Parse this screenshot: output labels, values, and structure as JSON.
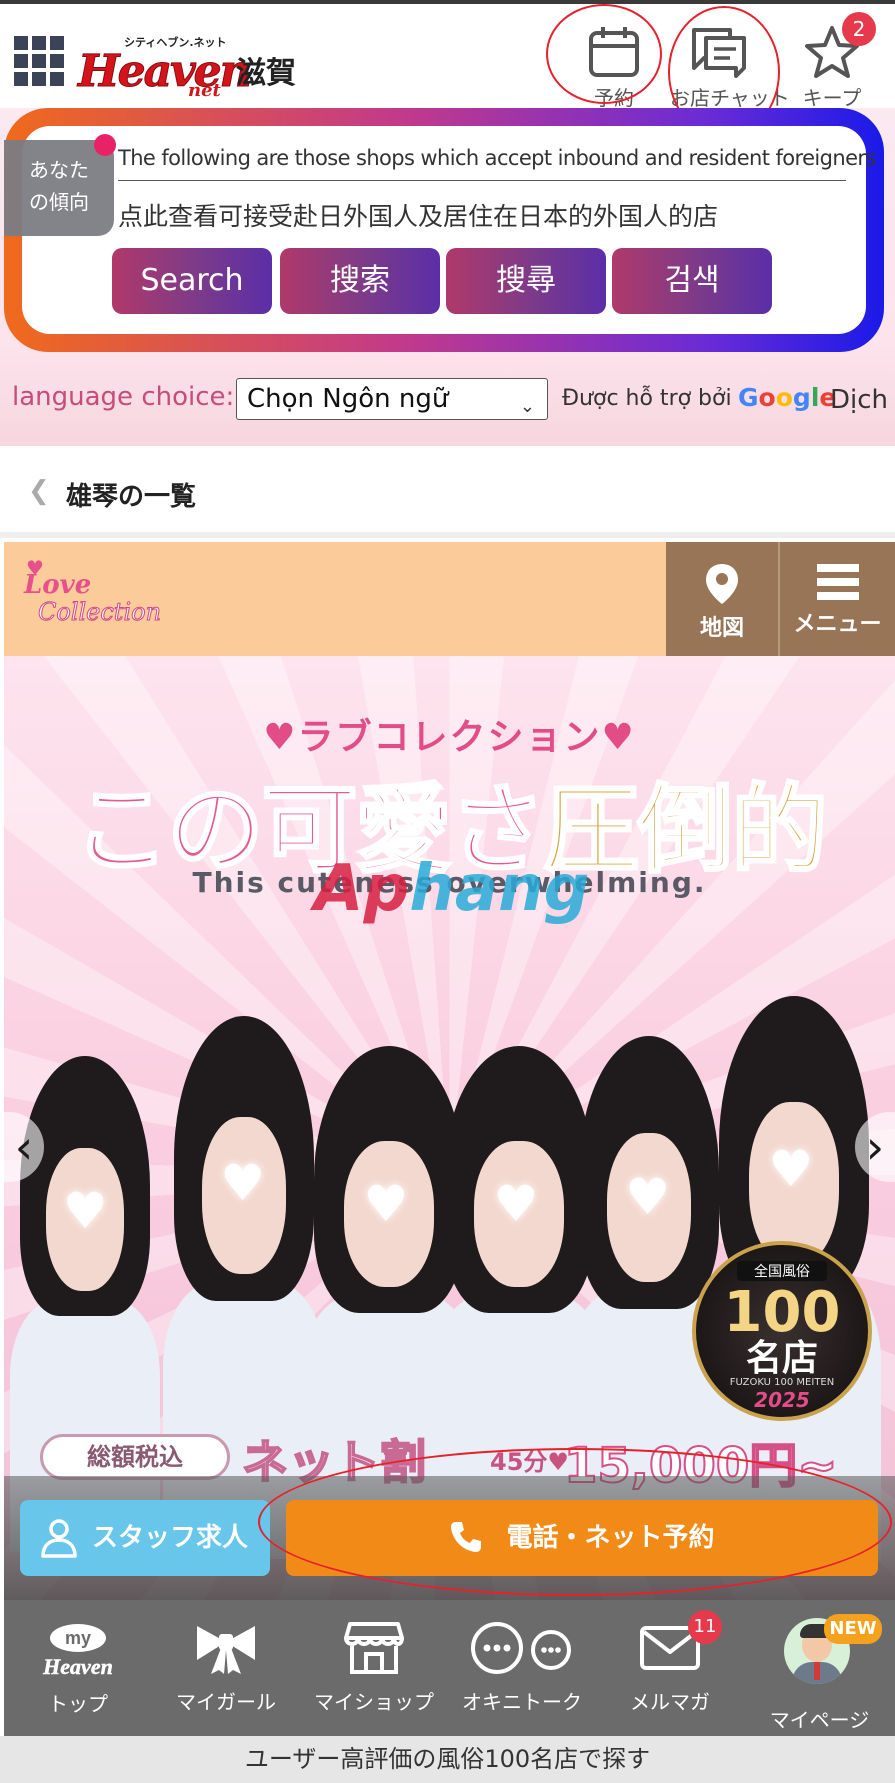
{
  "header": {
    "logo_tagline": "シティヘブン.ネット",
    "logo_name": "Heaven",
    "logo_suffix": "net",
    "region": "滋賀",
    "reserve_label": "予約",
    "chat_label": "お店チャット",
    "keep_label": "キープ",
    "keep_count": "2"
  },
  "language_banner": {
    "tendency_label_1": "あなた",
    "tendency_label_2": "の傾向",
    "en_text": "The following are those shops which accept inbound and resident foreigners",
    "zh_text": "点此查看可接受赴日外国人及居住在日本的外国人的店",
    "buttons": [
      "Search",
      "搜索",
      "搜尋",
      "검색"
    ],
    "choice_label": "language choice:",
    "select_value": "Chọn Ngôn ngữ",
    "powered_by": "Được hỗ trợ bởi",
    "google": "Google",
    "translate": "Dịch"
  },
  "breadcrumb": {
    "label": "雄琴の一覧"
  },
  "shop_header": {
    "logo_line1": "Love",
    "logo_line2": "Collection",
    "map_label": "地図",
    "menu_label": "メニュー"
  },
  "banner": {
    "subtitle": "ラブコレクション",
    "headline_a": "この可愛さ",
    "headline_b": "圧倒的",
    "english": "This cuteness overwhelming.",
    "watermark_a": "Ap",
    "watermark_b": "hang",
    "badge_top": "全国風俗",
    "badge_num": "100",
    "badge_mid": "名店",
    "badge_sub": "FUZOKU 100 MEITEN",
    "badge_year": "2025",
    "tax_pill": "総額税込",
    "net_discount": "ネット割",
    "minutes": "45分♥",
    "price": "15,000円~"
  },
  "actions": {
    "staff_label": "スタッフ求人",
    "call_label": "電話・ネット予約"
  },
  "bottom_nav": {
    "items": [
      {
        "label": "トップ",
        "icon": "my-heaven-icon",
        "icon_text_1": "my",
        "icon_text_2": "Heaven"
      },
      {
        "label": "マイガール",
        "icon": "ribbon-icon"
      },
      {
        "label": "マイショップ",
        "icon": "shop-icon"
      },
      {
        "label": "オキニトーク",
        "icon": "chat-bubbles-icon"
      },
      {
        "label": "メルマガ",
        "icon": "mail-icon",
        "badge": "11"
      },
      {
        "label": "マイページ",
        "icon": "avatar-icon",
        "tag": "NEW"
      }
    ]
  },
  "footer": {
    "text": "ユーザー高評価の風俗100名店で探す"
  },
  "colors": {
    "accent_red": "#d3141a",
    "search_btn": "#7b3a8a",
    "shop_header_bg": "#fbcb9a",
    "shop_btn_bg": "#977556",
    "staff_btn": "#67c6ea",
    "call_btn": "#f28a18",
    "nav_bg": "#6b6b6b",
    "badge_red": "#e6394c"
  }
}
